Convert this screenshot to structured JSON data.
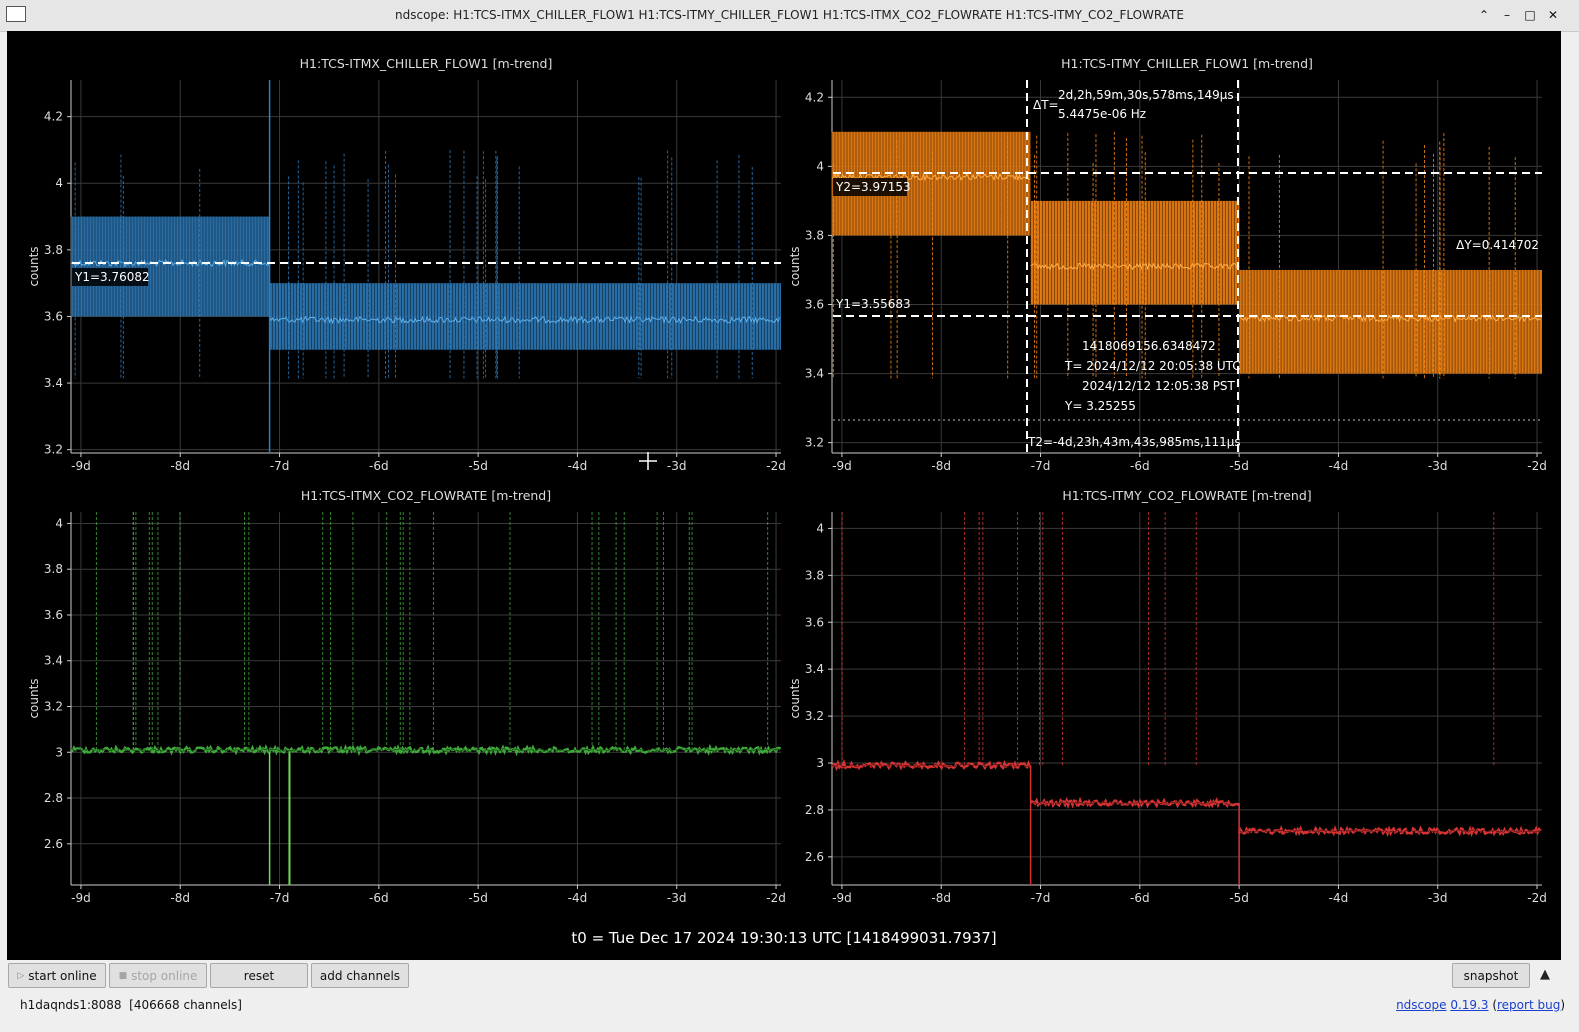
{
  "window": {
    "title": "ndscope: H1:TCS-ITMX_CHILLER_FLOW1 H1:TCS-ITMY_CHILLER_FLOW1 H1:TCS-ITMX_CO2_FLOWRATE H1:TCS-ITMY_CO2_FLOWRATE"
  },
  "window_controls": {
    "shade": "⌃",
    "minimize": "–",
    "maximize": "□",
    "close": "✕"
  },
  "colors": {
    "blue": "#2f7fc0",
    "orange": "#ff8a14",
    "green": "#3fa83a",
    "red": "#d63434"
  },
  "plots": [
    {
      "title": "H1:TCS-ITMX_CHILLER_FLOW1 [m-trend]",
      "ylabel": "counts",
      "yticks": [
        "4.2",
        "4",
        "3.8",
        "3.6",
        "3.4",
        "3.2"
      ],
      "xticks": [
        "-9d",
        "-8d",
        "-7d",
        "-6d",
        "-5d",
        "-4d",
        "-3d",
        "-2d"
      ]
    },
    {
      "title": "H1:TCS-ITMY_CHILLER_FLOW1 [m-trend]",
      "ylabel": "counts",
      "yticks": [
        "4.2",
        "4",
        "3.8",
        "3.6",
        "3.4",
        "3.2"
      ],
      "xticks": [
        "-9d",
        "-8d",
        "-7d",
        "-6d",
        "-5d",
        "-4d",
        "-3d",
        "-2d"
      ]
    },
    {
      "title": "H1:TCS-ITMX_CO2_FLOWRATE [m-trend]",
      "ylabel": "counts",
      "yticks": [
        "4",
        "3.8",
        "3.6",
        "3.4",
        "3.2",
        "3",
        "2.8",
        "2.6"
      ],
      "xticks": [
        "-9d",
        "-8d",
        "-7d",
        "-6d",
        "-5d",
        "-4d",
        "-3d",
        "-2d"
      ]
    },
    {
      "title": "H1:TCS-ITMY_CO2_FLOWRATE [m-trend]",
      "ylabel": "counts",
      "yticks": [
        "4",
        "3.8",
        "3.6",
        "3.4",
        "3.2",
        "3",
        "2.8",
        "2.6"
      ],
      "xticks": [
        "-9d",
        "-8d",
        "-7d",
        "-6d",
        "-5d",
        "-4d",
        "-3d",
        "-2d"
      ]
    }
  ],
  "cursors": {
    "p1_y1": "Y1=3.76082",
    "p2_y2": "Y2=3.97153",
    "p2_y1": "Y1=3.55683",
    "p2_dt_label": "ΔT=",
    "p2_dt_value": "2d,2h,59m,30s,578ms,149μs",
    "p2_freq": "5.4475e-06 Hz",
    "p2_dy": "ΔY=0.414702",
    "p2_gps": "1418069156.6348472",
    "p2_t_utc": "T= 2024/12/12 20:05:38 UTC",
    "p2_t_pst": "2024/12/12 12:05:38 PST",
    "p2_y": "Y= 3.25255",
    "p2_t2": "T2=-4d,23h,43m,43s,985ms,111μs"
  },
  "t0": "t0 = Tue Dec 17 2024 19:30:13 UTC [1418499031.7937]",
  "toolbar": {
    "start_online": "start online",
    "stop_online": "stop online",
    "reset": "reset",
    "add_channels": "add channels",
    "snapshot": "snapshot",
    "expand": "▲"
  },
  "status": {
    "server": "h1daqnds1:8088",
    "channels": "[406668 channels]",
    "app": "ndscope",
    "version": "0.19.3",
    "report": "report bug",
    "open_paren": " (",
    "close_paren": ")"
  },
  "chart_data": [
    {
      "type": "line",
      "title": "H1:TCS-ITMX_CHILLER_FLOW1 [m-trend]",
      "ylabel": "counts",
      "xlim": [
        -9.1,
        -1.95
      ],
      "ylim": [
        3.19,
        4.31
      ],
      "series": [
        {
          "x": [
            -9.1,
            -7.1,
            -7.1,
            -1.95
          ],
          "mean": [
            3.76,
            3.76,
            3.59,
            3.59
          ],
          "max": [
            3.9,
            3.9,
            3.7,
            3.7
          ],
          "min": [
            3.6,
            3.6,
            3.5,
            3.5
          ]
        }
      ]
    },
    {
      "type": "line",
      "title": "H1:TCS-ITMY_CHILLER_FLOW1 [m-trend]",
      "ylabel": "counts",
      "xlim": [
        -9.1,
        -1.95
      ],
      "ylim": [
        3.17,
        4.25
      ],
      "series": [
        {
          "x": [
            -9.1,
            -7.1,
            -7.1,
            -5.0,
            -5.0,
            -1.95
          ],
          "mean": [
            3.97,
            3.97,
            3.71,
            3.71,
            3.56,
            3.56
          ],
          "max": [
            4.1,
            4.1,
            3.9,
            3.9,
            3.7,
            3.7
          ],
          "min": [
            3.8,
            3.8,
            3.6,
            3.6,
            3.4,
            3.4
          ]
        }
      ]
    },
    {
      "type": "line",
      "title": "H1:TCS-ITMX_CO2_FLOWRATE [m-trend]",
      "ylabel": "counts",
      "xlim": [
        -9.1,
        -1.95
      ],
      "ylim": [
        2.42,
        4.05
      ],
      "series": [
        {
          "x": [
            -9.1,
            -1.95
          ],
          "mean": [
            3.01,
            3.03
          ],
          "max": [
            3.05,
            3.07
          ],
          "min": [
            2.98,
            3.0
          ]
        }
      ]
    },
    {
      "type": "line",
      "title": "H1:TCS-ITMY_CO2_FLOWRATE [m-trend]",
      "ylabel": "counts",
      "xlim": [
        -9.1,
        -1.95
      ],
      "ylim": [
        2.48,
        4.07
      ],
      "series": [
        {
          "x": [
            -9.1,
            -7.1,
            -7.1,
            -5.0,
            -5.0,
            -1.95
          ],
          "mean": [
            2.99,
            2.99,
            2.83,
            2.83,
            2.71,
            2.71
          ],
          "max": [
            3.02,
            3.02,
            2.86,
            2.86,
            2.74,
            2.74
          ],
          "min": [
            2.97,
            2.97,
            2.81,
            2.81,
            2.69,
            2.69
          ]
        }
      ]
    }
  ]
}
